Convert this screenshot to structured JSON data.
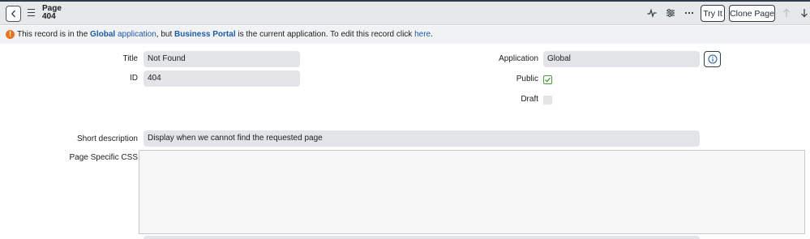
{
  "header": {
    "record_type": "Page",
    "record_name": "404",
    "try_it_label": "Try It",
    "clone_page_label": "Clone Page"
  },
  "notice": {
    "part1": "This record is in the ",
    "scope_name": "Global",
    "part2": " application",
    "part3": ", but ",
    "current_app": "Business Portal",
    "part4": " is the current application. To edit this record click ",
    "link_text": "here",
    "part5": "."
  },
  "form": {
    "title_label": "Title",
    "title_value": "Not Found",
    "id_label": "ID",
    "id_value": "404",
    "application_label": "Application",
    "application_value": "Global",
    "public_label": "Public",
    "public_checked": true,
    "draft_label": "Draft",
    "draft_checked": false,
    "short_description_label": "Short description",
    "short_description_value": "Display when we cannot find the requested page",
    "page_css_label": "Page Specific CSS",
    "page_css_value": ""
  },
  "colors": {
    "link": "#1e5aa8",
    "warning": "#e8741d",
    "checked": "#4b9a3a",
    "field_bg": "#e2e4e7"
  },
  "icons": {
    "back": "chevron-left-icon",
    "menu": "hamburger-icon",
    "activity": "activity-pulse-icon",
    "settings": "sliders-icon",
    "more": "more-dots-icon",
    "up": "arrow-up-icon",
    "down": "arrow-down-icon",
    "info": "info-icon",
    "warning": "warning-icon",
    "checkbox": "checkmark-icon"
  }
}
